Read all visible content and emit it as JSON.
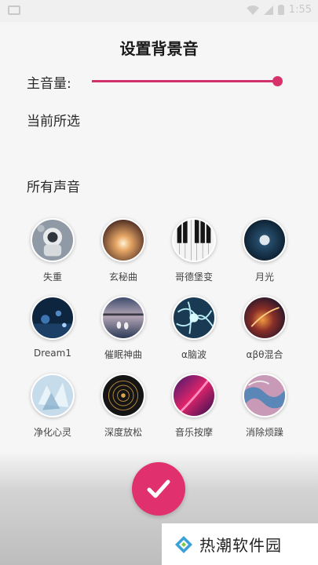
{
  "status_bar": {
    "time": "1:55"
  },
  "header": {
    "title": "设置背景音"
  },
  "volume": {
    "label": "主音量:",
    "level_percent": 100
  },
  "current": {
    "label": "当前所选"
  },
  "all_sounds": {
    "label": "所有声音"
  },
  "sounds": [
    {
      "label": "失重",
      "icon": "astronaut-image"
    },
    {
      "label": "玄秘曲",
      "icon": "glowing-sun-image"
    },
    {
      "label": "哥德堡变",
      "icon": "piano-keys-image"
    },
    {
      "label": "月光",
      "icon": "moon-image"
    },
    {
      "label": "Dream1",
      "icon": "night-lights-image"
    },
    {
      "label": "催眠神曲",
      "icon": "swan-lake-image"
    },
    {
      "label": "α脑波",
      "icon": "neurons-image"
    },
    {
      "label": "αβθ混合",
      "icon": "nebula-image"
    },
    {
      "label": "净化心灵",
      "icon": "crystal-image"
    },
    {
      "label": "深度放松",
      "icon": "radial-pattern-image"
    },
    {
      "label": "音乐按摩",
      "icon": "light-streak-image"
    },
    {
      "label": "消除烦躁",
      "icon": "fluid-art-image"
    }
  ],
  "confirm": {
    "icon": "check-icon"
  },
  "watermark": {
    "text": "热潮软件园"
  },
  "colors": {
    "accent": "#e0306d",
    "slider": "#d2316b"
  }
}
